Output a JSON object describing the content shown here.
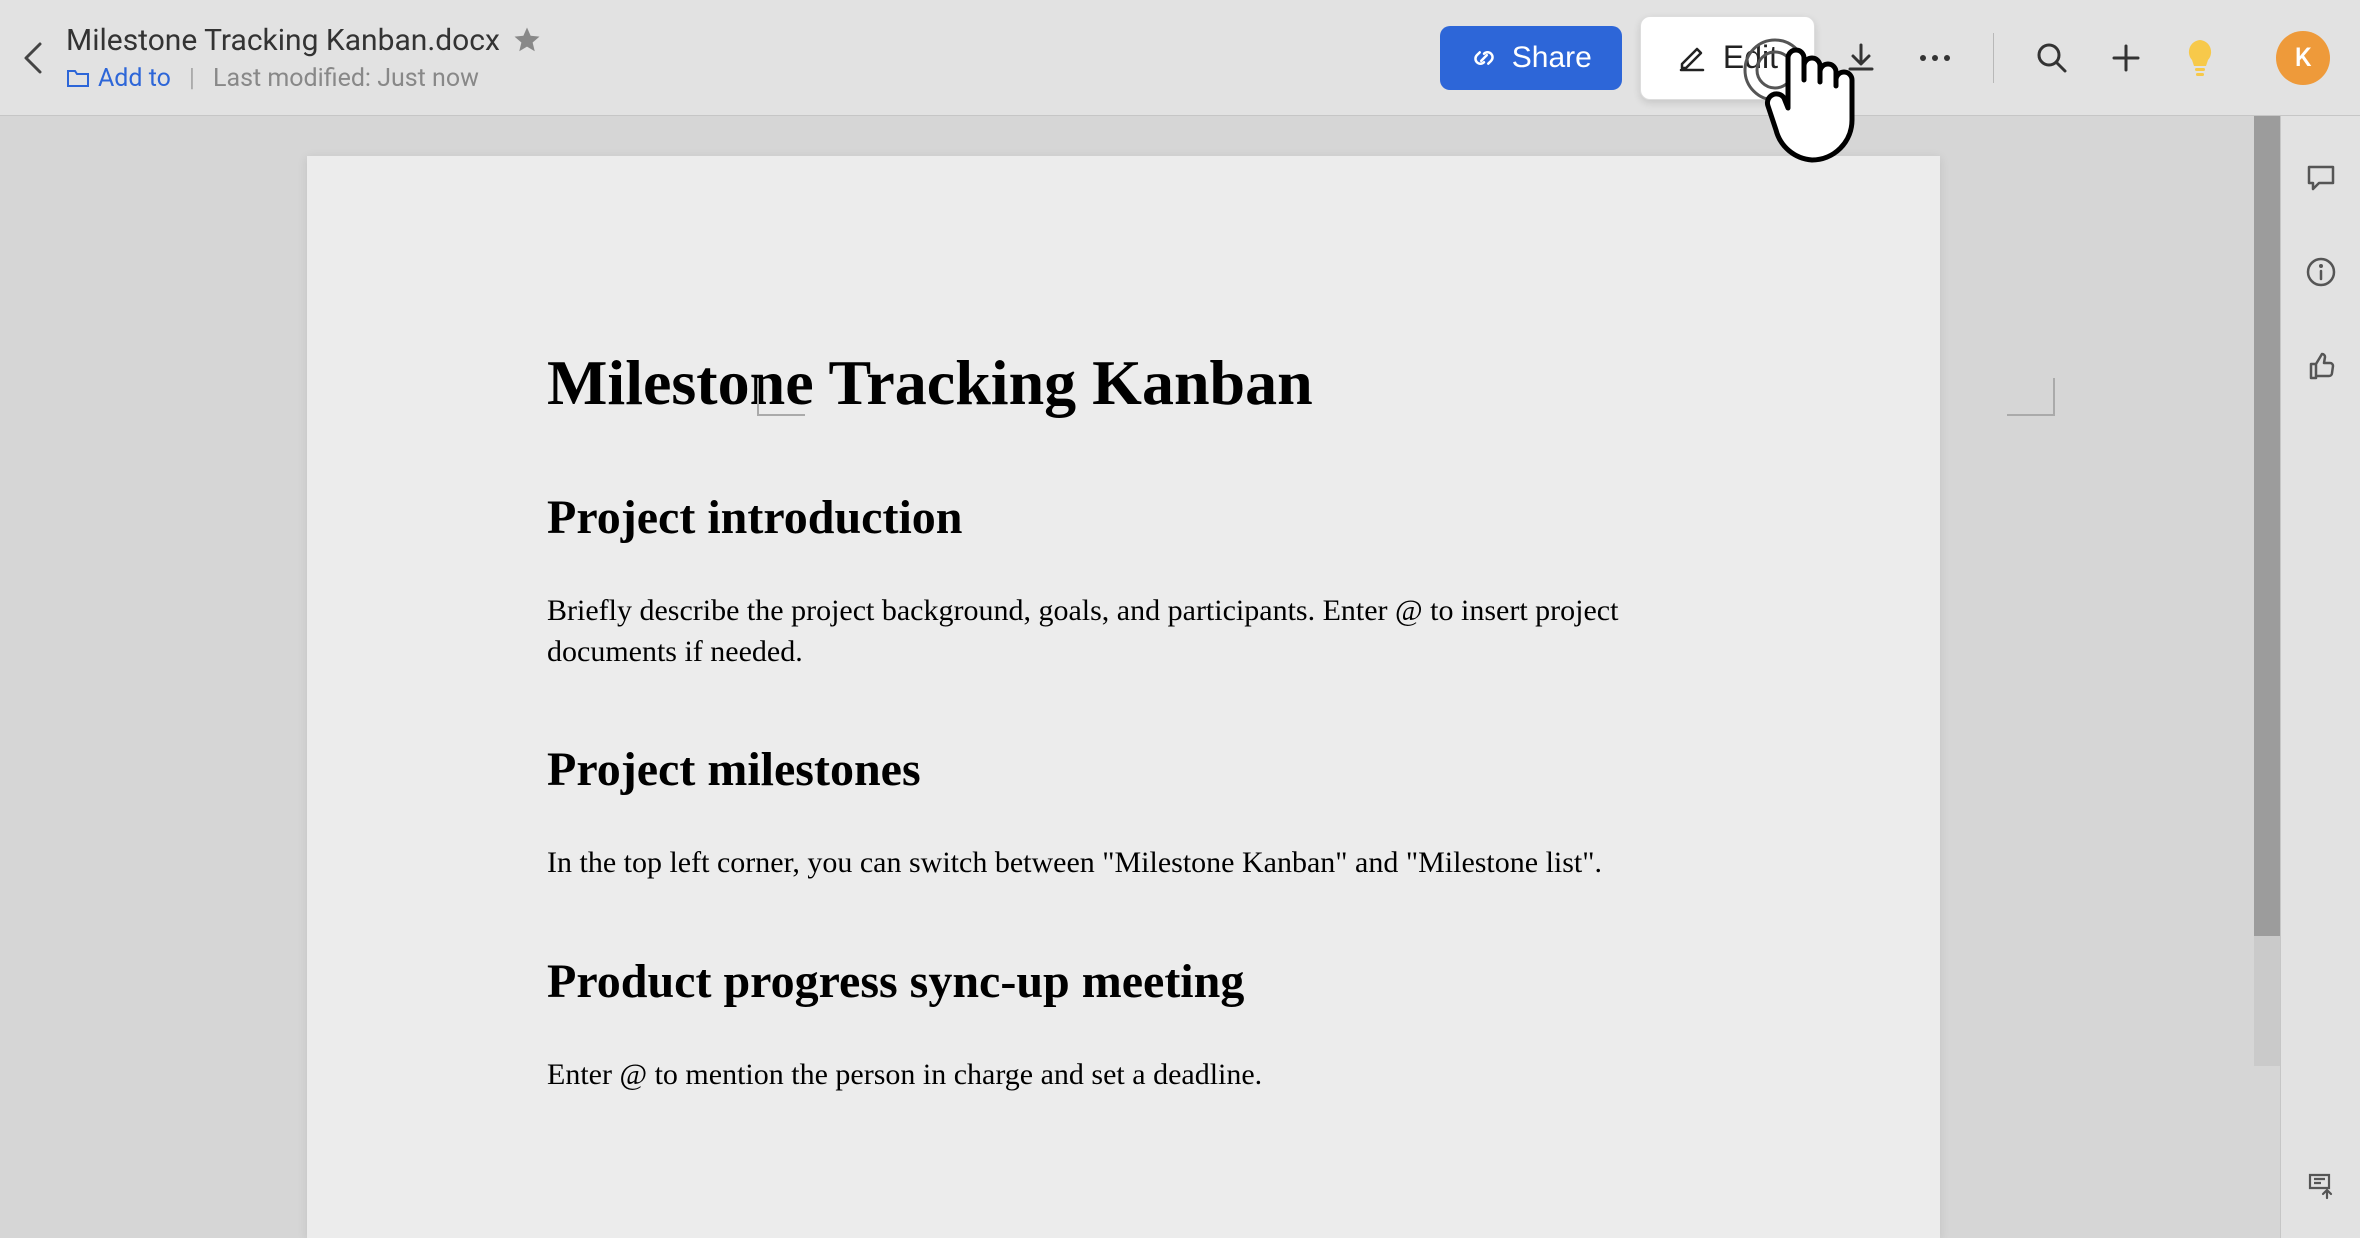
{
  "header": {
    "doc_title": "Milestone Tracking Kanban.docx",
    "add_to_label": "Add to",
    "last_modified_label": "Last modified: Just now"
  },
  "toolbar": {
    "share_label": "Share",
    "edit_label": "Edit"
  },
  "avatar": {
    "initial": "K"
  },
  "document": {
    "h1": "Milestone Tracking Kanban",
    "section1_heading": "Project introduction",
    "section1_body": "Briefly describe the project background, goals, and participants. Enter @ to insert project documents if needed.",
    "section2_heading": "Project milestones",
    "section2_body": "In the top left corner, you can switch between \"Milestone Kanban\" and \"Milestone list\".",
    "section3_heading": "Product progress sync-up meeting",
    "section3_body": "Enter @ to mention the person in charge and set a deadline."
  }
}
